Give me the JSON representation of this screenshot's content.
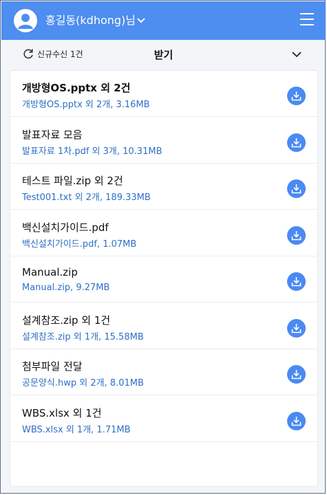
{
  "header": {
    "user_name": "홍길동(kdhong)님",
    "avatar_icon": "user-avatar-icon",
    "menu_icon": "hamburger-menu-icon",
    "accent_color": "#4d8ef0"
  },
  "toolbar": {
    "refresh_label": "신규수신 1건",
    "title": "받기",
    "refresh_icon": "refresh-icon",
    "expand_icon": "chevron-down-icon"
  },
  "files": [
    {
      "title": "개방형OS.pptx 외 2건",
      "detail": "개방형OS.pptx 외 2개, 3.16MB",
      "bold": true
    },
    {
      "title": "발표자료 모음",
      "detail": "발표자료 1차.pdf 외 3개, 10.31MB",
      "bold": false
    },
    {
      "title": "테스트 파일.zip 외 2건",
      "detail": "Test001.txt 외 2개, 189.33MB",
      "bold": false
    },
    {
      "title": "백신설치가이드.pdf",
      "detail": "백신설치가이드.pdf,  1.07MB",
      "bold": false
    },
    {
      "title": "Manual.zip",
      "detail": "Manual.zip, 9.27MB",
      "bold": false
    },
    {
      "title": "설계참조.zip 외 1건",
      "detail": "설계참조.zip 외 1개, 15.58MB",
      "bold": false
    },
    {
      "title": "첨부파일 전달",
      "detail": "공문양식.hwp  외 2개, 8.01MB",
      "bold": false
    },
    {
      "title": "WBS.xlsx 외 1건",
      "detail": "WBS.xlsx 외 1개, 1.71MB",
      "bold": false
    }
  ],
  "download_icon": "download-icon",
  "detail_color": "#2e6fc7"
}
